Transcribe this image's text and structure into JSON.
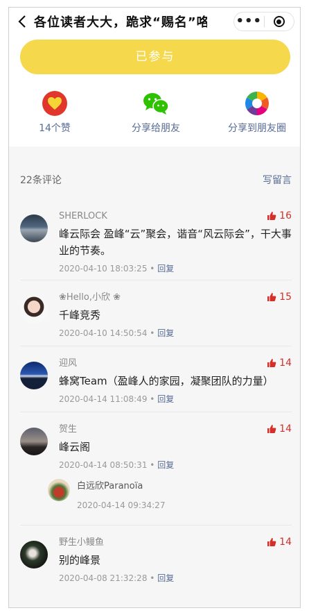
{
  "nav": {
    "title": "各位读者大大，跪求“赐名”咯...",
    "more": "•••"
  },
  "joined_button": "已参与",
  "actions": [
    {
      "label": "14个赞",
      "icon": "heart-icon"
    },
    {
      "label": "分享给朋友",
      "icon": "wechat-icon"
    },
    {
      "label": "分享到朋友圈",
      "icon": "moments-icon"
    }
  ],
  "comments_header": {
    "count": "22条评论",
    "write": "写留言"
  },
  "comments": [
    {
      "name": "SHERLOCK",
      "text": "峰云际会 盈峰“云”聚会，谐音“风云际会”，干大事业的节奏。",
      "time": "2020-04-10 18:03:25",
      "likes": "16"
    },
    {
      "name": "❀Hello,小欣 ❀",
      "text": "千峰竞秀",
      "time": "2020-04-10 14:50:54",
      "likes": "15"
    },
    {
      "name": "迎风",
      "text": "蜂窝Team（盈峰人的家园，凝聚团队的力量）",
      "time": "2020-04-14 11:08:49",
      "likes": "14"
    },
    {
      "name": "贺生",
      "text": "峰云阁",
      "time": "2020-04-14 08:50:31",
      "likes": "14"
    },
    {
      "name": "野生小鳗鱼",
      "text": "别的峰景",
      "time": "2020-04-08 21:32:28",
      "likes": "14"
    }
  ],
  "sub_reply": {
    "name": "白远欣Paranoïa",
    "time": "2020-04-14 09:34:27"
  },
  "meta": {
    "dot": "•",
    "reply": "回复"
  },
  "colors": {
    "accent_yellow": "#f6d84c",
    "link_blue": "#576b95",
    "like_red": "#d4302a"
  }
}
